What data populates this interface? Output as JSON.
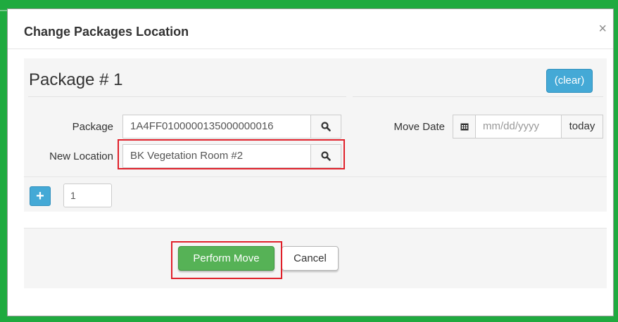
{
  "colors": {
    "frame_green": "#1faa3f",
    "primary_blue": "#44a9d6",
    "success_green": "#56b256",
    "highlight_red": "#e0202a"
  },
  "dialog": {
    "title": "Change Packages Location",
    "close_label": "×"
  },
  "package_block": {
    "heading": "Package # 1",
    "clear_label": "(clear)",
    "package_label": "Package",
    "package_value": "1A4FF0100000135000000016",
    "package_search_icon": "search-icon",
    "new_location_label": "New Location",
    "new_location_value": "BK Vegetation Room #2",
    "location_search_icon": "search-icon",
    "move_date_label": "Move Date",
    "calendar_icon": "calendar-icon",
    "move_date_placeholder": "mm/dd/yyyy",
    "today_label": "today",
    "add_icon": "+",
    "quantity_value": "1"
  },
  "footer": {
    "perform_label": "Perform Move",
    "cancel_label": "Cancel"
  }
}
